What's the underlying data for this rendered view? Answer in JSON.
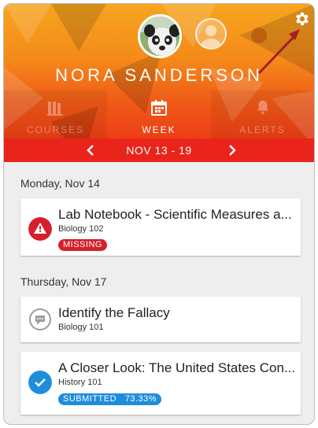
{
  "profile": {
    "name": "NORA SANDERSON"
  },
  "tabs": [
    {
      "label": "COURSES",
      "icon": "courses-icon"
    },
    {
      "label": "WEEK",
      "icon": "calendar-icon"
    },
    {
      "label": "ALERTS",
      "icon": "bell-icon"
    }
  ],
  "week_nav": {
    "range": "NOV 13 - 19"
  },
  "days": [
    {
      "label": "Monday, Nov 14",
      "items": [
        {
          "title": "Lab Notebook - Scientific Measures a...",
          "course": "Biology 102",
          "status": "MISSING",
          "icon": "warning-icon",
          "status_color": "#d5202b"
        }
      ]
    },
    {
      "label": "Thursday, Nov 17",
      "items": [
        {
          "title": "Identify the Fallacy",
          "course": "Biology 101",
          "status": "",
          "icon": "discussion-icon"
        },
        {
          "title": "A Closer Look: The United States  Con...",
          "course": "History 101",
          "status": "SUBMITTED   73.33%",
          "icon": "check-icon",
          "status_color": "#1e8ddc"
        }
      ]
    }
  ],
  "colors": {
    "header_top": "#f7a51f",
    "header_bottom": "#ea2e14",
    "missing": "#d5202b",
    "submitted": "#1e8ddc",
    "annotation_arrow": "#a31f22"
  }
}
